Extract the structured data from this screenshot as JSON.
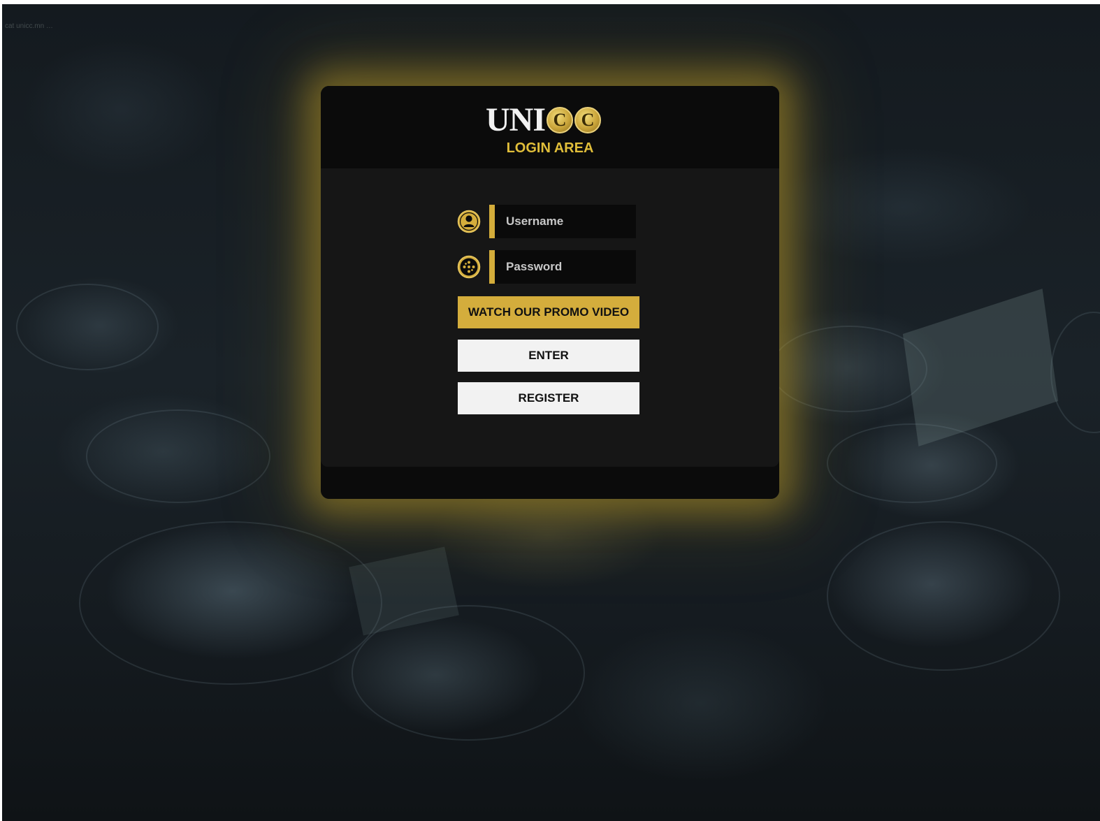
{
  "background": {
    "top_text": "cat unicc.mn …"
  },
  "header": {
    "logo_text": "UNI",
    "logo_coin_letter": "C",
    "subtitle": "LOGIN AREA"
  },
  "form": {
    "username": {
      "placeholder": "Username",
      "value": "",
      "icon": "user-icon"
    },
    "password": {
      "placeholder": "Password",
      "value": "",
      "icon": "keypad-icon"
    }
  },
  "buttons": {
    "promo_label": "WATCH OUR PROMO VIDEO",
    "enter_label": "ENTER",
    "register_label": "REGISTER"
  },
  "colors": {
    "accent_gold": "#d4ad3c",
    "card_dark": "#0b0b0b",
    "card_body": "#161616",
    "button_light": "#f2f2f2"
  }
}
